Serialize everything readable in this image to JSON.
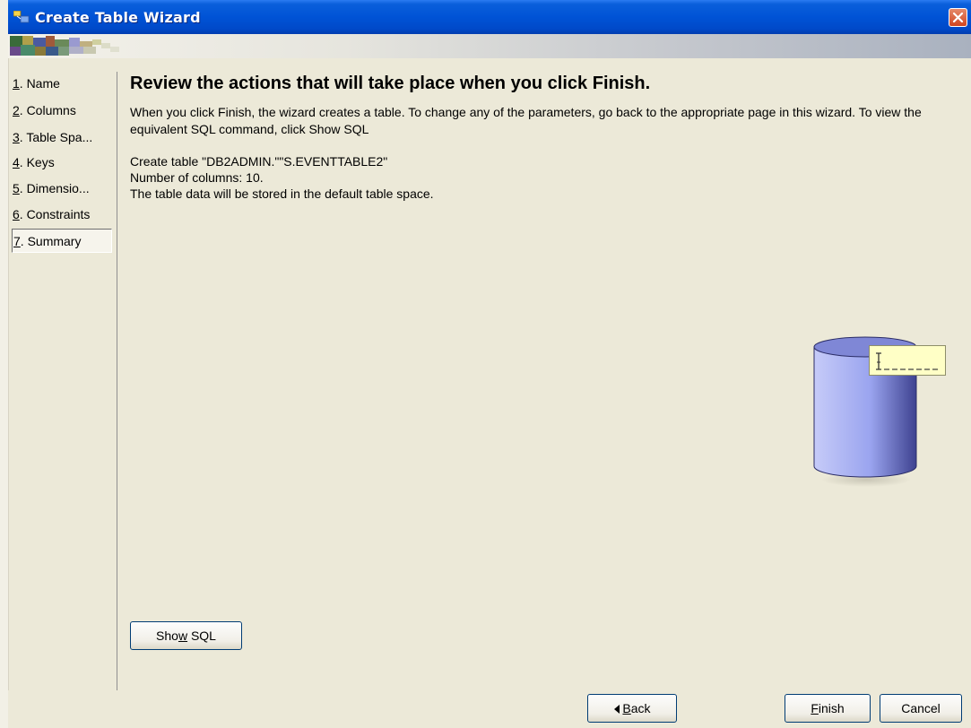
{
  "window": {
    "title": "Create Table Wizard"
  },
  "nav": {
    "items": [
      {
        "mn": "1",
        "rest": ". Name"
      },
      {
        "mn": "2",
        "rest": ". Columns"
      },
      {
        "mn": "3",
        "rest": ". Table Spa..."
      },
      {
        "mn": "4",
        "rest": ". Keys"
      },
      {
        "mn": "5",
        "rest": ". Dimensio..."
      },
      {
        "mn": "6",
        "rest": ". Constraints"
      },
      {
        "mn": "7",
        "rest": ". Summary"
      }
    ],
    "selected_index": 6
  },
  "summary": {
    "heading": "Review the actions that will take place when you click Finish.",
    "intro": "When you click Finish, the wizard creates a table. To change any of the parameters, go back to the appropriate page in this wizard. To view the equivalent SQL command, click Show SQL",
    "details": [
      "Create table \"DB2ADMIN.\"\"S.EVENTTABLE2\"",
      "Number of columns: 10.",
      "The table data will be stored in the default table space."
    ]
  },
  "buttons": {
    "show_sql": {
      "before": "Sho",
      "mn": "w",
      "after": " SQL"
    },
    "back": {
      "mn": "B",
      "after": "ack"
    },
    "finish": {
      "mn": "F",
      "after": "inish"
    },
    "cancel": "Cancel"
  },
  "tooltip": {
    "text": "I-----"
  },
  "colors": {
    "titlebar": "#0053d6",
    "cylinder": "#9aa4ef",
    "tooltip": "#ffffc6"
  }
}
